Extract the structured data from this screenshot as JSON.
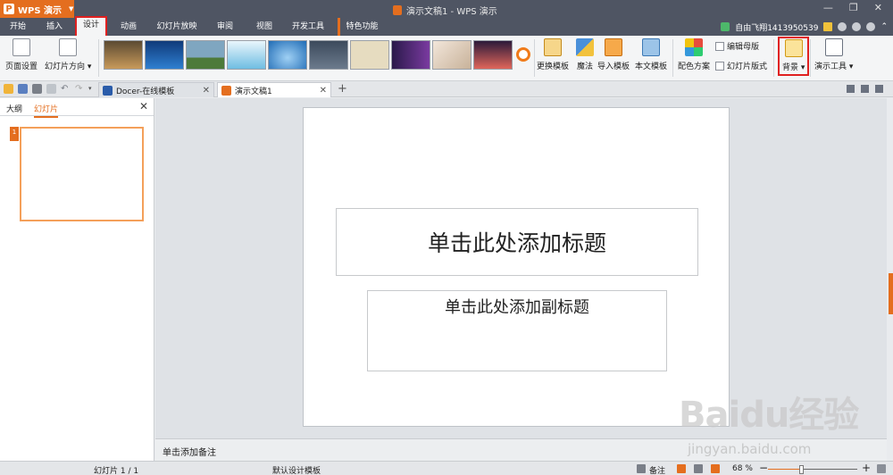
{
  "titlebar": {
    "app_name": "WPS 演示",
    "window_title": "演示文稿1 - WPS 演示"
  },
  "menu": {
    "tabs": [
      "开始",
      "插入",
      "设计",
      "动画",
      "幻灯片放映",
      "审阅",
      "视图",
      "开发工具",
      "特色功能"
    ],
    "active_tab": "设计",
    "user_name": "自由飞翔1413950539"
  },
  "ribbon": {
    "page_setup": "页面设置",
    "slide_orientation": "幻灯片方向",
    "change_template": "更换模板",
    "magic": "魔法",
    "import_template": "导入模板",
    "this_template": "本文模板",
    "color_scheme": "配色方案",
    "edit_master": "编辑母版",
    "slide_layout": "幻灯片版式",
    "background": "背景",
    "presentation_tools": "演示工具"
  },
  "doc_tabs": {
    "docer_label": "Docer-在线模板",
    "doc_label": "演示文稿1"
  },
  "left_panel": {
    "outline_tab": "大纲",
    "slides_tab": "幻灯片",
    "slide_number": "1"
  },
  "slide": {
    "title_placeholder": "单击此处添加标题",
    "subtitle_placeholder": "单击此处添加副标题"
  },
  "notes": {
    "placeholder": "单击添加备注"
  },
  "statusbar": {
    "slide_counter": "幻灯片 1 / 1",
    "template_name": "默认设计模板",
    "notes_label": "备注",
    "zoom_level": "68 %",
    "zoom_fraction": 0.68
  },
  "watermark": {
    "brand": "Baidu经验",
    "url": "jingyan.baidu.com"
  },
  "colors": {
    "accent": "#e46e1f",
    "dark_bar": "#4f5563",
    "highlight_red": "#e02020"
  }
}
